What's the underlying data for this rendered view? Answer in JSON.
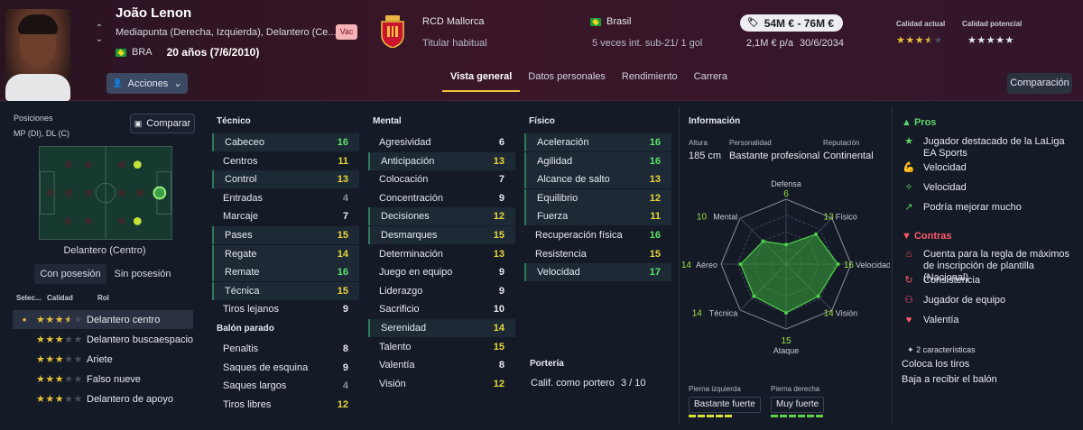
{
  "player": {
    "name": "João Lenon",
    "positions": "Mediapunta (Derecha, Izquierda), Delantero (Ce...",
    "nation_code": "BRA",
    "age": "20 años (7/6/2010)",
    "badge": "Vac",
    "actions_label": "Acciones"
  },
  "club": {
    "name": "RCD Mallorca",
    "role": "Titular habitual"
  },
  "nationality": {
    "country": "Brasil",
    "caps": "5 veces int. sub-21/ 1 gol"
  },
  "contract": {
    "value": "54M € - 76M €",
    "wage": "2,1M € p/a",
    "expires": "30/6/2034"
  },
  "ability": {
    "current_label": "Calidad actual",
    "current_stars": 3.5,
    "potential_label": "Calidad potencial",
    "potential_stars": 5
  },
  "tabs": [
    {
      "label": "Vista general",
      "active": true
    },
    {
      "label": "Datos personales",
      "active": false
    },
    {
      "label": "Rendimiento",
      "active": false
    },
    {
      "label": "Carrera",
      "active": false
    }
  ],
  "compare_top": "Comparación",
  "left": {
    "positions_title": "Posiciones",
    "positions_value": "MP (DI), DL (C)",
    "compare_label": "Comparar",
    "selected_position": "Delantero (Centro)",
    "toggle_on": "Con posesión",
    "toggle_off": "Sin posesión",
    "roles_headers": [
      "Selec...",
      "Calidad",
      "Rol"
    ],
    "roles": [
      {
        "stars": 3.5,
        "label": "Delantero centro",
        "selected": true
      },
      {
        "stars": 3,
        "label": "Delantero buscaespacio",
        "selected": false
      },
      {
        "stars": 3,
        "label": "Ariete",
        "selected": false
      },
      {
        "stars": 3,
        "label": "Falso nueve",
        "selected": false
      },
      {
        "stars": 3,
        "label": "Delantero de apoyo",
        "selected": false
      }
    ]
  },
  "tecnico": {
    "title": "Técnico",
    "attrs": [
      {
        "n": "Cabeceo",
        "v": "16",
        "c": "gg",
        "hl": 1
      },
      {
        "n": "Centros",
        "v": "11",
        "c": "y",
        "hl": 0
      },
      {
        "n": "Control",
        "v": "13",
        "c": "y",
        "hl": 1
      },
      {
        "n": "Entradas",
        "v": "4",
        "c": "gr",
        "hl": 0
      },
      {
        "n": "Marcaje",
        "v": "7",
        "c": "g",
        "hl": 0
      },
      {
        "n": "Pases",
        "v": "15",
        "c": "y",
        "hl": 1
      },
      {
        "n": "Regate",
        "v": "14",
        "c": "y",
        "hl": 1
      },
      {
        "n": "Remate",
        "v": "16",
        "c": "gg",
        "hl": 1
      },
      {
        "n": "Técnica",
        "v": "15",
        "c": "y",
        "hl": 1
      },
      {
        "n": "Tiros lejanos",
        "v": "9",
        "c": "g",
        "hl": 0
      }
    ]
  },
  "balon_parado": {
    "title": "Balón parado",
    "attrs": [
      {
        "n": "Penaltis",
        "v": "8",
        "c": "g",
        "hl": 0
      },
      {
        "n": "Saques de esquina",
        "v": "9",
        "c": "g",
        "hl": 0
      },
      {
        "n": "Saques largos",
        "v": "4",
        "c": "gr",
        "hl": 0
      },
      {
        "n": "Tiros libres",
        "v": "12",
        "c": "y",
        "hl": 0
      }
    ]
  },
  "mental": {
    "title": "Mental",
    "attrs": [
      {
        "n": "Agresividad",
        "v": "6",
        "c": "g",
        "hl": 0
      },
      {
        "n": "Anticipación",
        "v": "13",
        "c": "y",
        "hl": 1
      },
      {
        "n": "Colocación",
        "v": "7",
        "c": "g",
        "hl": 0
      },
      {
        "n": "Concentración",
        "v": "9",
        "c": "g",
        "hl": 0
      },
      {
        "n": "Decisiones",
        "v": "12",
        "c": "y",
        "hl": 1
      },
      {
        "n": "Desmarques",
        "v": "15",
        "c": "y",
        "hl": 1
      },
      {
        "n": "Determinación",
        "v": "13",
        "c": "y",
        "hl": 0
      },
      {
        "n": "Juego en equipo",
        "v": "9",
        "c": "g",
        "hl": 0
      },
      {
        "n": "Liderazgo",
        "v": "9",
        "c": "g",
        "hl": 0
      },
      {
        "n": "Sacrificio",
        "v": "10",
        "c": "g",
        "hl": 0
      },
      {
        "n": "Serenidad",
        "v": "14",
        "c": "y",
        "hl": 1
      },
      {
        "n": "Talento",
        "v": "15",
        "c": "y",
        "hl": 0
      },
      {
        "n": "Valentía",
        "v": "8",
        "c": "g",
        "hl": 0
      },
      {
        "n": "Visión",
        "v": "12",
        "c": "y",
        "hl": 0
      }
    ]
  },
  "fisico": {
    "title": "Físico",
    "attrs": [
      {
        "n": "Aceleración",
        "v": "16",
        "c": "gg",
        "hl": 1
      },
      {
        "n": "Agilidad",
        "v": "16",
        "c": "gg",
        "hl": 1
      },
      {
        "n": "Alcance de salto",
        "v": "13",
        "c": "y",
        "hl": 1
      },
      {
        "n": "Equilibrio",
        "v": "12",
        "c": "y",
        "hl": 1
      },
      {
        "n": "Fuerza",
        "v": "11",
        "c": "y",
        "hl": 1
      },
      {
        "n": "Recuperación física",
        "v": "16",
        "c": "gg",
        "hl": 0
      },
      {
        "n": "Resistencia",
        "v": "15",
        "c": "y",
        "hl": 0
      },
      {
        "n": "Velocidad",
        "v": "17",
        "c": "gg",
        "hl": 1
      }
    ]
  },
  "porteria": {
    "title": "Portería",
    "label": "Calif. como portero",
    "value": "3 / 10"
  },
  "info": {
    "title": "Información",
    "height_label": "Altura",
    "height": "185 cm",
    "personality_label": "Personalidad",
    "personality": "Bastante profesional",
    "reputation_label": "Reputación",
    "reputation": "Continental",
    "left_foot_label": "Pierna izquierda",
    "left_foot": "Bastante fuerte",
    "right_foot_label": "Pierna derecha",
    "right_foot": "Muy fuerte"
  },
  "radar": {
    "axes": [
      {
        "label": "Defensa",
        "value": 6
      },
      {
        "label": "Físico",
        "value": 13
      },
      {
        "label": "Velocidad",
        "value": 16
      },
      {
        "label": "Visión",
        "value": 14
      },
      {
        "label": "Ataque",
        "value": 15
      },
      {
        "label": "Técnica",
        "value": 14
      },
      {
        "label": "Aéreo",
        "value": 14
      },
      {
        "label": "Mental",
        "value": 10
      }
    ],
    "max": 20
  },
  "pros": {
    "title": "Pros",
    "items": [
      {
        "icon": "star-icon",
        "text": "Jugador destacado de la LaLiga EA Sports"
      },
      {
        "icon": "muscle-icon",
        "text": "Velocidad"
      },
      {
        "icon": "sparkle-icon",
        "text": "Velocidad"
      },
      {
        "icon": "trend-up-icon",
        "text": "Podría mejorar mucho"
      }
    ]
  },
  "contras": {
    "title": "Contras",
    "items": [
      {
        "icon": "home-alert-icon",
        "text": "Cuenta para la regla de máximos de inscripción de plantilla (Nacional)"
      },
      {
        "icon": "cycle-icon",
        "text": "Consistencia"
      },
      {
        "icon": "team-icon",
        "text": "Jugador de equipo"
      },
      {
        "icon": "heart-icon",
        "text": "Valentía"
      }
    ]
  },
  "traits": {
    "title": "2 características",
    "items": [
      "Coloca los tiros",
      "Baja a recibir el balón"
    ]
  }
}
